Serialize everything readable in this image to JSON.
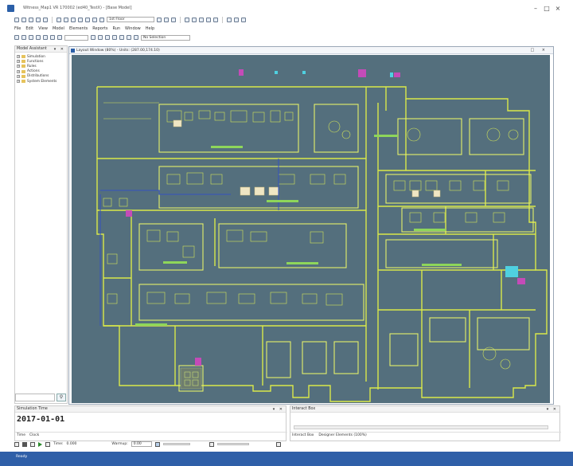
{
  "window": {
    "title": "Witness_Map1 VR 170002 (ed40_TestX) - [Base Model]",
    "btn_min": "–",
    "btn_max": "□",
    "btn_close": "×"
  },
  "toolbar": {
    "floor_value": "1st Floor",
    "selection_value": "No Selection"
  },
  "menu": [
    "File",
    "Edit",
    "View",
    "Model",
    "Elements",
    "Reports",
    "Run",
    "Window",
    "Help"
  ],
  "model_assistant": {
    "title": "Model Assistant",
    "controls": "▾ ✕",
    "items": [
      {
        "label": "Simulation"
      },
      {
        "label": "Functions"
      },
      {
        "label": "Rules"
      },
      {
        "label": "Actions"
      },
      {
        "label": "Distributions"
      },
      {
        "label": "System Elements"
      }
    ]
  },
  "layout_window": {
    "title": "Layout Window (80%) - Units: (287.00,174.10)",
    "controls": "□ ×"
  },
  "simulation_time": {
    "title": "Simulation Time",
    "date": "2017-01-01",
    "tabs": [
      "Time",
      "Clock"
    ],
    "controls": "▾ ✕"
  },
  "interact_box": {
    "title": "Interact Box",
    "tabs": [
      "Interact Box",
      "Designer Elements (100%)"
    ],
    "controls": "▾ ✕"
  },
  "run_controls": {
    "time_label": "Time:",
    "time_value": "0.000",
    "warmup_label": "Warmup:",
    "warmup_value": "0.00"
  },
  "status": {
    "text": "Ready"
  },
  "colors": {
    "canvas_bg": "#546f7d",
    "walls": "#d9e84a",
    "accent": "#2f5fa8"
  }
}
